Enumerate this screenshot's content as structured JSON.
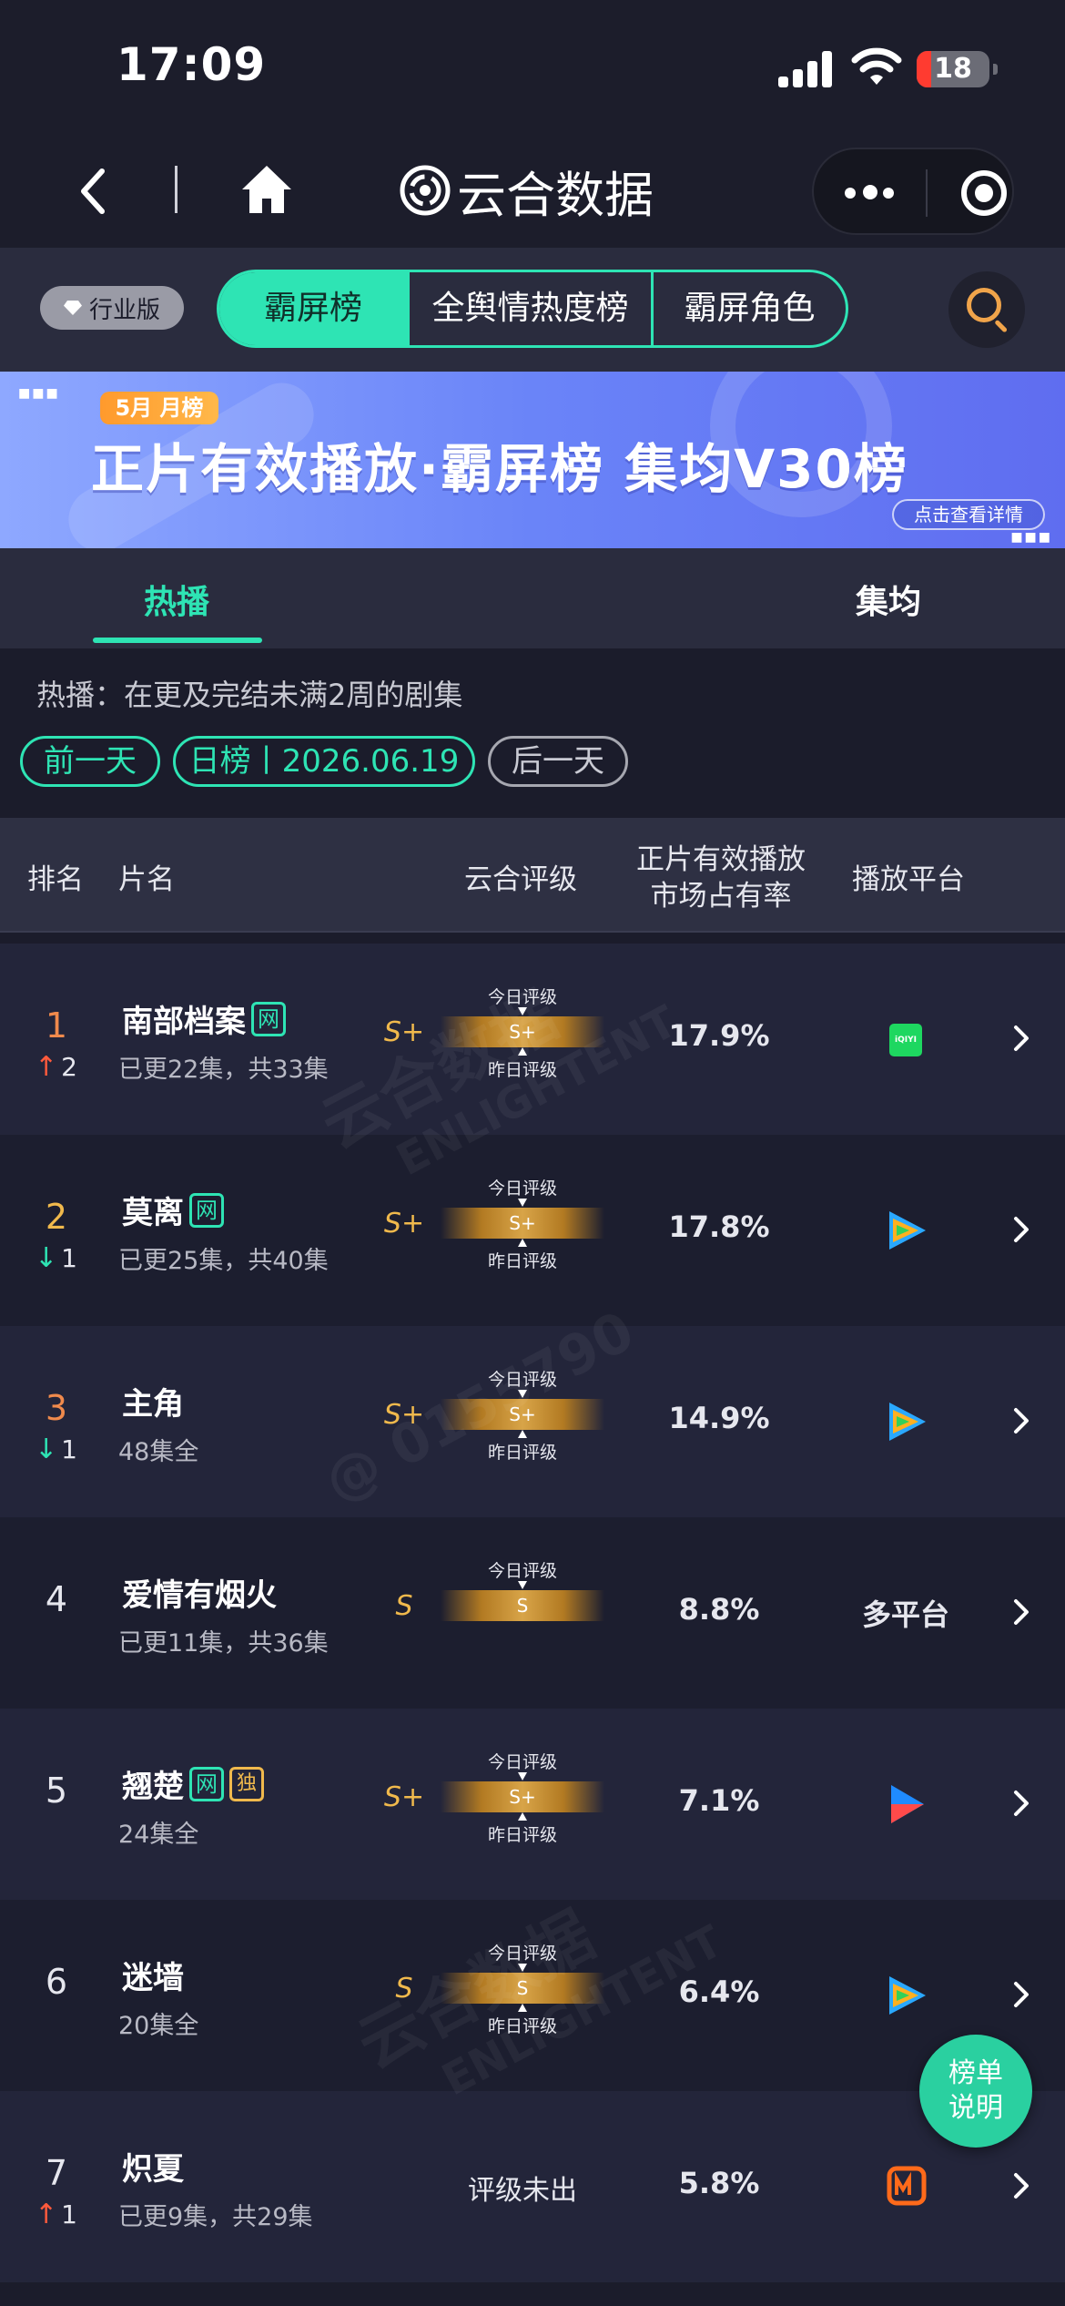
{
  "status_bar": {
    "time": "17:09",
    "battery": "18"
  },
  "nav": {
    "title": "云合数据"
  },
  "filters": {
    "edition": "行业版",
    "tabs": [
      "霸屏榜",
      "全舆情热度榜",
      "霸屏角色"
    ],
    "active_tab": 0
  },
  "banner": {
    "tag": "5月 月榜",
    "title": "正片有效播放·霸屏榜 集均V30榜",
    "detail_button": "点击查看详情"
  },
  "sub_tabs": {
    "hot": "热播",
    "avg": "集均"
  },
  "description": "热播：在更及完结未满2周的剧集",
  "date_nav": {
    "prev": "前一天",
    "current": "日榜丨2026.06.19",
    "next": "后一天"
  },
  "table_header": {
    "rank": "排名",
    "name": "片名",
    "grade": "云合评级",
    "share_line1": "正片有效播放",
    "share_line2": "市场占有率",
    "platform": "播放平台"
  },
  "grade_labels": {
    "today": "今日评级",
    "yesterday": "昨日评级"
  },
  "rows": [
    {
      "rank": "1",
      "change": "2",
      "dir": "up",
      "name": "南部档案",
      "tags": [
        "网"
      ],
      "episodes": "已更22集，共33集",
      "grade": "S+",
      "bar": "S+",
      "share": "17.9%",
      "platform": "iqiyi"
    },
    {
      "rank": "2",
      "change": "1",
      "dir": "down",
      "name": "莫离",
      "tags": [
        "网"
      ],
      "episodes": "已更25集，共40集",
      "grade": "S+",
      "bar": "S+",
      "share": "17.8%",
      "platform": "tencent"
    },
    {
      "rank": "3",
      "change": "1",
      "dir": "down",
      "name": "主角",
      "tags": [],
      "episodes": "48集全",
      "grade": "S+",
      "bar": "S+",
      "share": "14.9%",
      "platform": "tencent"
    },
    {
      "rank": "4",
      "change": "",
      "dir": "",
      "name": "爱情有烟火",
      "tags": [],
      "episodes": "已更11集，共36集",
      "grade": "S",
      "bar": "S",
      "share": "8.8%",
      "platform": "text",
      "platform_text": "多平台",
      "no_yesterday": true
    },
    {
      "rank": "5",
      "change": "",
      "dir": "",
      "name": "翘楚",
      "tags": [
        "网",
        "独"
      ],
      "episodes": "24集全",
      "grade": "S+",
      "bar": "S+",
      "share": "7.1%",
      "platform": "youku"
    },
    {
      "rank": "6",
      "change": "",
      "dir": "",
      "name": "迷墙",
      "tags": [],
      "episodes": "20集全",
      "grade": "S",
      "bar": "S",
      "share": "6.4%",
      "platform": "tencent"
    },
    {
      "rank": "7",
      "change": "1",
      "dir": "up",
      "name": "炽夏",
      "tags": [],
      "episodes": "已更9集，共29集",
      "grade": "",
      "no_grade_text": "评级未出",
      "share": "5.8%",
      "platform": "mango"
    }
  ],
  "fab": {
    "line1": "榜单",
    "line2": "说明"
  },
  "watermarks": [
    "云合数据",
    "ENLIGHTENT",
    "@ 0155790"
  ],
  "colors": {
    "accent": "#2ee4b4",
    "gold": "#f0b94c",
    "up": "#ff5a3c",
    "down": "#2ee4b4"
  }
}
